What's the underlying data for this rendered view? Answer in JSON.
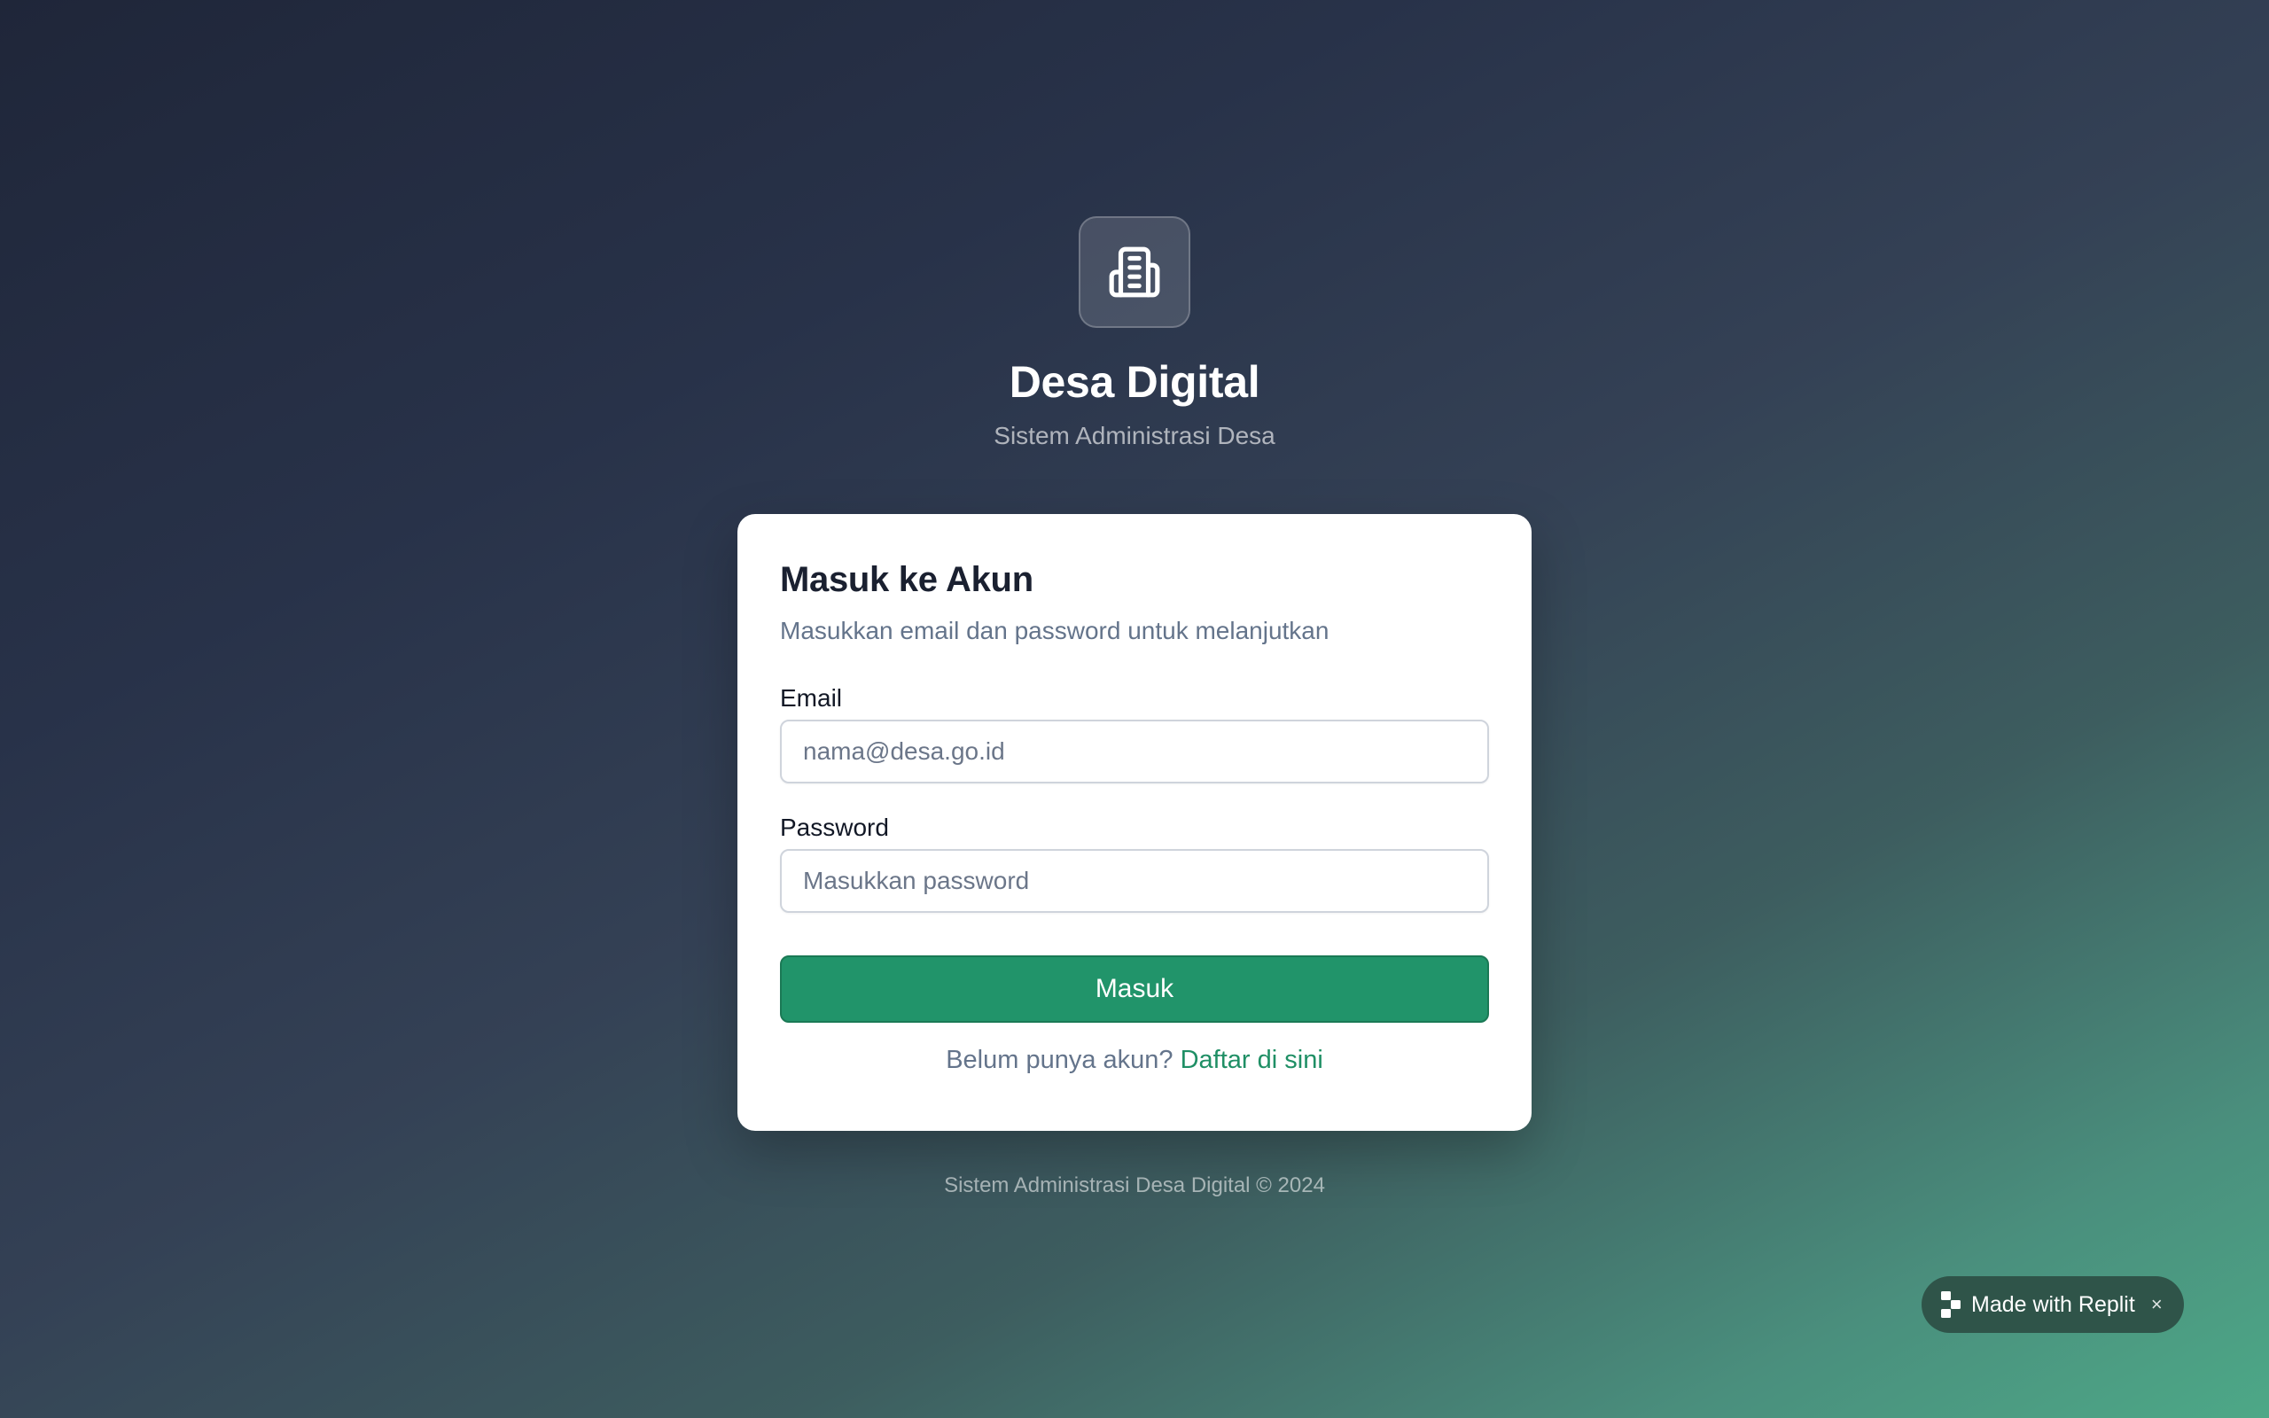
{
  "brand": {
    "logo_icon": "building-icon",
    "title": "Desa Digital",
    "subtitle": "Sistem Administrasi Desa"
  },
  "login_card": {
    "title": "Masuk ke Akun",
    "description": "Masukkan email dan password untuk melanjutkan",
    "email": {
      "label": "Email",
      "value": "",
      "placeholder": "nama@desa.go.id"
    },
    "password": {
      "label": "Password",
      "value": "",
      "placeholder": "Masukkan password"
    },
    "submit_label": "Masuk",
    "register_prompt": "Belum punya akun?",
    "register_link": "Daftar di sini"
  },
  "footer": {
    "text": "Sistem Administrasi Desa Digital © 2024"
  },
  "replit_badge": {
    "icon": "replit-icon",
    "label": "Made with Replit",
    "close_label": "×"
  },
  "colors": {
    "primary": "#21946a",
    "link": "#1f8f65",
    "background_start": "#1f2639",
    "background_end": "#4da887",
    "badge": "#2f5449"
  }
}
